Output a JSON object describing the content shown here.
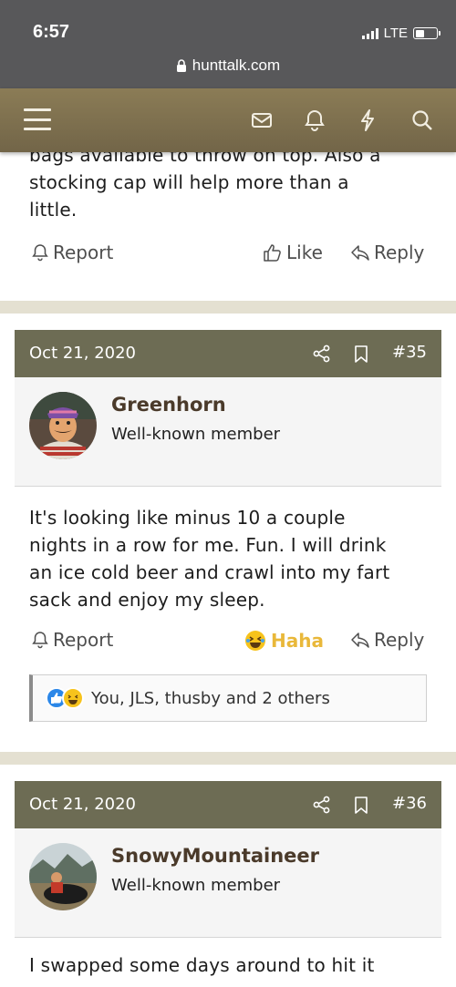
{
  "status": {
    "time": "6:57",
    "network": "LTE",
    "url": "hunttalk.com"
  },
  "posts": [
    {
      "text_lines": [
        "bags available to throw on top. Also a",
        "stocking cap will help more than a",
        "little."
      ],
      "actions": {
        "report": "Report",
        "like": "Like",
        "reply": "Reply"
      }
    },
    {
      "date": "Oct 21, 2020",
      "number": "#35",
      "username": "Greenhorn",
      "user_title": "Well-known member",
      "text_lines": [
        "It's looking like minus 10 a couple",
        "nights in a row for me. Fun. I will drink",
        "an ice cold beer and crawl into my fart",
        "sack and enjoy my sleep."
      ],
      "actions": {
        "report": "Report",
        "reaction": "Haha",
        "reply": "Reply"
      },
      "reactions_summary": "You, JLS, thusby and 2 others"
    },
    {
      "date": "Oct 21, 2020",
      "number": "#36",
      "username": "SnowyMountaineer",
      "user_title": "Well-known member",
      "text_lines": [
        "I swapped some days around to hit it"
      ]
    }
  ],
  "colors": {
    "nav": "#7d6f4f",
    "post_header": "#6d6c54",
    "haha": "#e9b83a",
    "username": "#4a3a2a"
  }
}
